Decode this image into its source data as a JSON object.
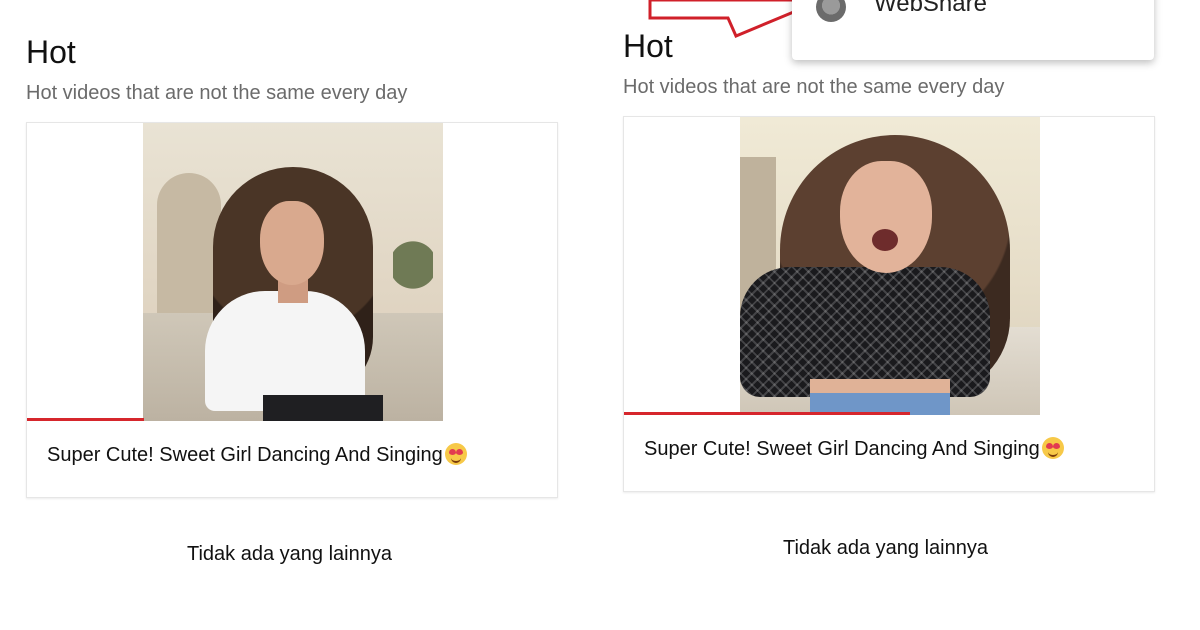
{
  "panels": [
    {
      "section": {
        "title": "Hot",
        "subtitle": "Hot videos that are not the same every day"
      },
      "video": {
        "caption": "Super Cute! Sweet Girl Dancing And Singing",
        "emoji_icon": "heart-eyes-emoji",
        "progress_percent": 22
      },
      "footer_text": "Tidak ada yang lainnya"
    },
    {
      "section": {
        "title": "Hot",
        "subtitle": "Hot videos that are not the same every day"
      },
      "video": {
        "caption": "Super Cute! Sweet Girl Dancing And Singing",
        "emoji_icon": "heart-eyes-emoji",
        "progress_percent": 54
      },
      "footer_text": "Tidak ada yang lainnya"
    }
  ],
  "popup": {
    "label": "WebShare",
    "icon": "globe-icon"
  },
  "annotation": {
    "icon": "red-arrow-callout",
    "color": "#d0202a"
  },
  "colors": {
    "progress": "#d6262c",
    "subtitle": "#6b6b6b"
  }
}
